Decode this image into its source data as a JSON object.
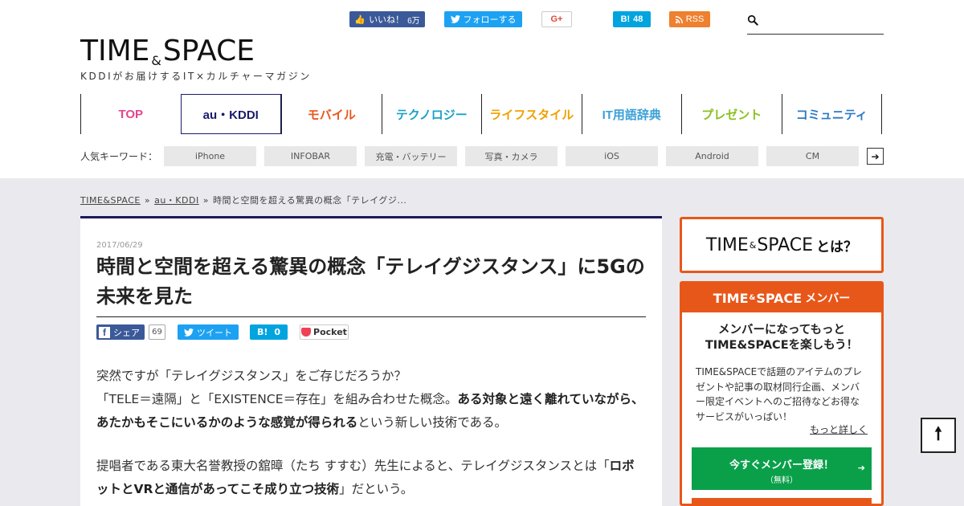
{
  "header": {
    "social": {
      "like_label": "いいね！",
      "like_count": "6万",
      "follow_label": "フォローする",
      "gplus_label": "G+",
      "hatena_label": "B!",
      "hatena_count": "48",
      "rss_label": "RSS"
    },
    "search": {
      "placeholder": "",
      "value": ""
    },
    "logo": {
      "left": "TIME",
      "amp": "&",
      "right": "SPACE"
    },
    "tagline": "KDDIがお届けするIT×カルチャーマガジン",
    "nav": [
      {
        "label": "TOP",
        "color": "#e4458e"
      },
      {
        "label": "au・KDDI",
        "color": "#1a1a6b"
      },
      {
        "label": "モバイル",
        "color": "#e8571a"
      },
      {
        "label": "テクノロジー",
        "color": "#1aa0c8"
      },
      {
        "label": "ライフスタイル",
        "color": "#f0a000"
      },
      {
        "label": "IT用語辞典",
        "color": "#3aa0d8"
      },
      {
        "label": "プレゼント",
        "color": "#8cc020"
      },
      {
        "label": "コミュニティ",
        "color": "#2a7ac8"
      }
    ],
    "keywords": {
      "label": "人気キーワード：",
      "items": [
        "iPhone",
        "INFOBAR",
        "充電・バッテリー",
        "写真・カメラ",
        "iOS",
        "Android",
        "CM"
      ],
      "more_icon": "arrow-right-icon"
    }
  },
  "breadcrumb": {
    "items": [
      "TIME&SPACE",
      "au・KDDI"
    ],
    "separator": "»",
    "current": "時間と空間を超える驚異の概念「テレイグジ..."
  },
  "article": {
    "date": "2017/06/29",
    "title": "時間と空間を超える驚異の概念「テレイグジスタンス」に5Gの未来を見た",
    "share": {
      "fb_label": "シェア",
      "fb_count": "69",
      "tweet_label": "ツイート",
      "hatena_label": "B!",
      "hatena_count": "0",
      "pocket_label": "Pocket"
    },
    "paragraphs": {
      "p1_line1": "突然ですが「テレイグジスタンス」をご存じだろうか？",
      "p1_a": "「TELE＝遠隔」と「EXISTENCE＝存在」を組み合わせた概念。",
      "p1_bold": "ある対象と遠く離れていながら、あたかもそこにいるかのような感覚が得られる",
      "p1_c": "という新しい技術である。",
      "p2_a": "提唱者である東大名誉教授の舘暲（たち すすむ）先生によると、テレイグジスタンスとは「",
      "p2_bold": "ロボットとVRと通信があってこそ成り立つ技術",
      "p2_c": "」だという。"
    }
  },
  "sidebar": {
    "about": {
      "left": "TIME",
      "amp": "&",
      "right": "SPACE",
      "suffix": "とは？"
    },
    "member": {
      "header_left": "TIME",
      "header_amp": "&",
      "header_right": "SPACE",
      "header_suffix": " メンバー",
      "lead_line1": "メンバーになってもっと",
      "lead_line2": "TIME&SPACEを楽しもう！",
      "desc": "TIME&SPACEで話題のアイテムのプレゼントや記事の取材同行企画、メンバー限定イベントへのご招待などお得なサービスがいっぱい！",
      "more_link": "もっと詳しく",
      "register_label": "今すぐメンバー登録！",
      "register_sub": "（無料）"
    }
  },
  "back_to_top_icon": "arrow-up-icon",
  "colors": {
    "accent": "#e8571a",
    "navy": "#1a1a5a",
    "green": "#0aa04a",
    "facebook": "#3b5998",
    "twitter": "#1da1f2",
    "hatena": "#00a4de",
    "rss": "#ee802f"
  }
}
